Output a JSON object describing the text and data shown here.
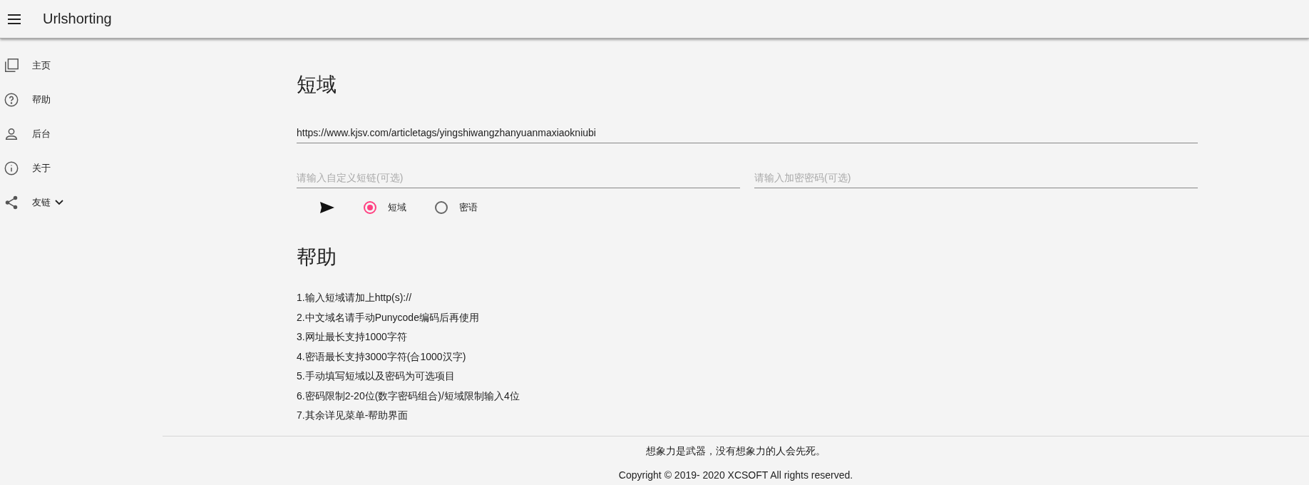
{
  "app_bar": {
    "title": "Urlshorting"
  },
  "sidebar": {
    "items": [
      {
        "kind": "home",
        "label": "主页",
        "expanded": false
      },
      {
        "kind": "help",
        "label": "帮助",
        "expanded": false
      },
      {
        "kind": "user",
        "label": "后台",
        "expanded": false
      },
      {
        "kind": "info",
        "label": "关于",
        "expanded": false
      },
      {
        "kind": "share",
        "label": "友链",
        "expanded": false,
        "expandable": true
      }
    ]
  },
  "form": {
    "title": "短域",
    "url_field": {
      "value": "https://www.kjsv.com/articletags/yingshiwangzhanyuanmaxiaokniubi"
    },
    "custom_field": {
      "placeholder": "请输入自定义短链(可选)"
    },
    "password_field": {
      "placeholder": "请输入加密密码(可选)"
    },
    "modes": [
      {
        "label": "短域",
        "selected": true
      },
      {
        "label": "密语",
        "selected": false
      }
    ]
  },
  "help": {
    "title": "帮助",
    "items": [
      "1.输入短域请加上http(s)://",
      "2.中文域名请手动Punycode编码后再使用",
      "3.网址最长支持1000字符",
      "4.密语最长支持3000字符(合1000汉字)",
      "5.手动填写短域以及密码为可选项目",
      "6.密码限制2-20位(数字密码组合)/短域限制输入4位",
      "7.其余详见菜单-帮助界面"
    ]
  },
  "footer": {
    "quote": "想象力是武器，没有想象力的人会先死。",
    "copyright": "Copyright © 2019- 2020 XCSOFT All rights reserved."
  }
}
